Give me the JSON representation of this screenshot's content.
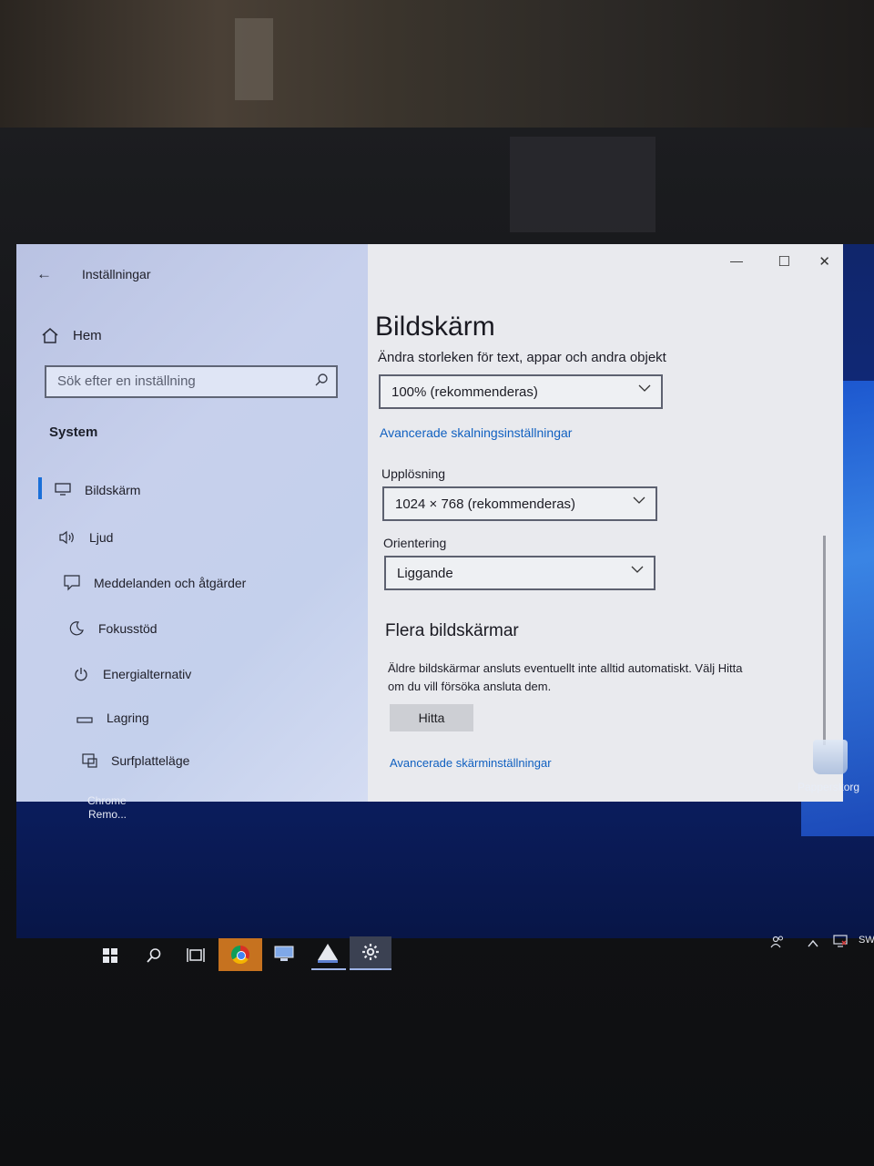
{
  "window": {
    "title": "Inställningar",
    "back_glyph": "←",
    "controls": {
      "minimize": "—",
      "maximize": "☐",
      "close": "✕"
    }
  },
  "sidebar": {
    "home_label": "Hem",
    "search_placeholder": "Sök efter en inställning",
    "section_title": "System",
    "items": [
      {
        "label": "Bildskärm",
        "icon": "monitor-icon",
        "glyph": "▭"
      },
      {
        "label": "Ljud",
        "icon": "speaker-icon",
        "glyph": "🔈"
      },
      {
        "label": "Meddelanden och åtgärder",
        "icon": "message-icon",
        "glyph": "🗨"
      },
      {
        "label": "Fokusstöd",
        "icon": "moon-icon",
        "glyph": "☽"
      },
      {
        "label": "Energialternativ",
        "icon": "power-icon",
        "glyph": "⏻"
      },
      {
        "label": "Lagring",
        "icon": "storage-icon",
        "glyph": "▭"
      },
      {
        "label": "Surfplatteläge",
        "icon": "tablet-icon",
        "glyph": "⧉"
      }
    ]
  },
  "main": {
    "page_title": "Bildskärm",
    "scale_label": "Ändra storleken för text, appar och andra objekt",
    "scale_value": "100% (rekommenderas)",
    "advanced_scaling_link": "Avancerade skalningsinställningar",
    "resolution_label": "Upplösning",
    "resolution_value": "1024 × 768 (rekommenderas)",
    "orientation_label": "Orientering",
    "orientation_value": "Liggande",
    "multi_heading": "Flera bildskärmar",
    "multi_text_1": "Äldre bildskärmar ansluts eventuellt inte alltid automatiskt. Välj Hitta",
    "multi_text_2": "om du vill försöka ansluta dem.",
    "find_button": "Hitta",
    "advanced_display_link": "Avancerade skärminställningar"
  },
  "desktop": {
    "shortcut_label_1": "Chrome",
    "shortcut_label_2": "Remo...",
    "recycle_label": "Papperskorg"
  },
  "taskbar": {
    "tray_lang": "SW"
  },
  "colors": {
    "accent": "#1060c0",
    "sidebar_bg": "#c7d0ec",
    "content_bg": "#e9eaee",
    "chrome_task": "#c6721f"
  }
}
